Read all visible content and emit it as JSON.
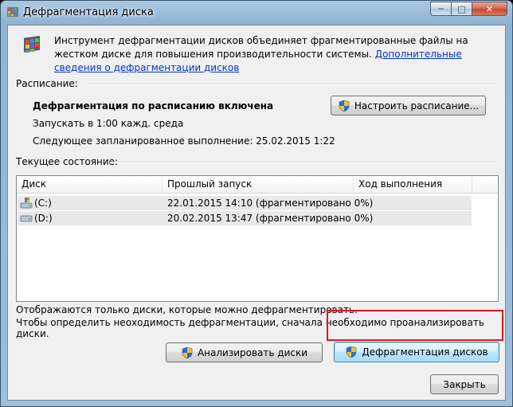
{
  "window": {
    "title": "Дефрагментация диска",
    "caption_buttons": {
      "minimize": "─",
      "maximize": "□",
      "close": "✕"
    }
  },
  "description": {
    "text": "Инструмент дефрагментации дисков объединяет фрагментированные файлы на жестком диске для повышения производительности системы.",
    "link": "Дополнительные сведения о дефрагментации дисков"
  },
  "schedule": {
    "group_label": "Расписание:",
    "status": "Дефрагментация по расписанию включена",
    "run_at": "Запускать в 1:00 кажд. среда",
    "next_run": "Следующее запланированное выполнение: 25.02.2015 1:22",
    "configure_button": "Настроить расписание..."
  },
  "current_state": {
    "group_label": "Текущее состояние:",
    "columns": [
      "Диск",
      "Прошлый запуск",
      "Ход выполнения"
    ],
    "rows": [
      {
        "disk": "(C:)",
        "last_run": "22.01.2015 14:10 (фрагментировано 0%)",
        "progress": "",
        "icon": "system-drive-icon"
      },
      {
        "disk": "(D:)",
        "last_run": "20.02.2015 13:47 (фрагментировано 0%)",
        "progress": "",
        "icon": "drive-icon"
      }
    ]
  },
  "info": {
    "line1": "Отображаются только диски, которые можно дефрагментировать.",
    "line2": "Чтобы определить неоходимость  дефрагментации, сначала необходимо проанализировать диски."
  },
  "buttons": {
    "analyze": "Анализировать диски",
    "defragment": "Дефрагментация дисков",
    "close": "Закрыть"
  },
  "colors": {
    "link": "#0033cc",
    "highlight_box": "#e3141c",
    "close_caption": "#c44a2d"
  }
}
